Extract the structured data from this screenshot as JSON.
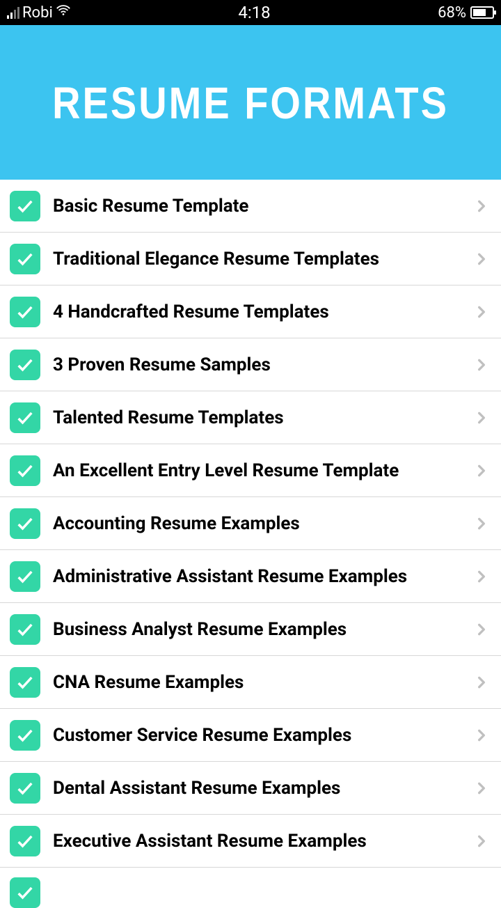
{
  "status_bar": {
    "carrier": "Robi",
    "time": "4:18",
    "battery_percent": "68%"
  },
  "header": {
    "title": "RESUME  FORMATS"
  },
  "list": {
    "items": [
      {
        "label": "Basic Resume Template"
      },
      {
        "label": "Traditional Elegance Resume Templates"
      },
      {
        "label": "4 Handcrafted Resume Templates"
      },
      {
        "label": "3 Proven Resume Samples"
      },
      {
        "label": "Talented Resume Templates"
      },
      {
        "label": "An Excellent Entry Level Resume Template"
      },
      {
        "label": "Accounting Resume Examples"
      },
      {
        "label": "Administrative Assistant Resume Examples"
      },
      {
        "label": "Business Analyst Resume Examples"
      },
      {
        "label": "CNA Resume Examples"
      },
      {
        "label": "Customer Service Resume Examples"
      },
      {
        "label": "Dental Assistant Resume Examples"
      },
      {
        "label": "Executive Assistant Resume Examples"
      }
    ]
  }
}
